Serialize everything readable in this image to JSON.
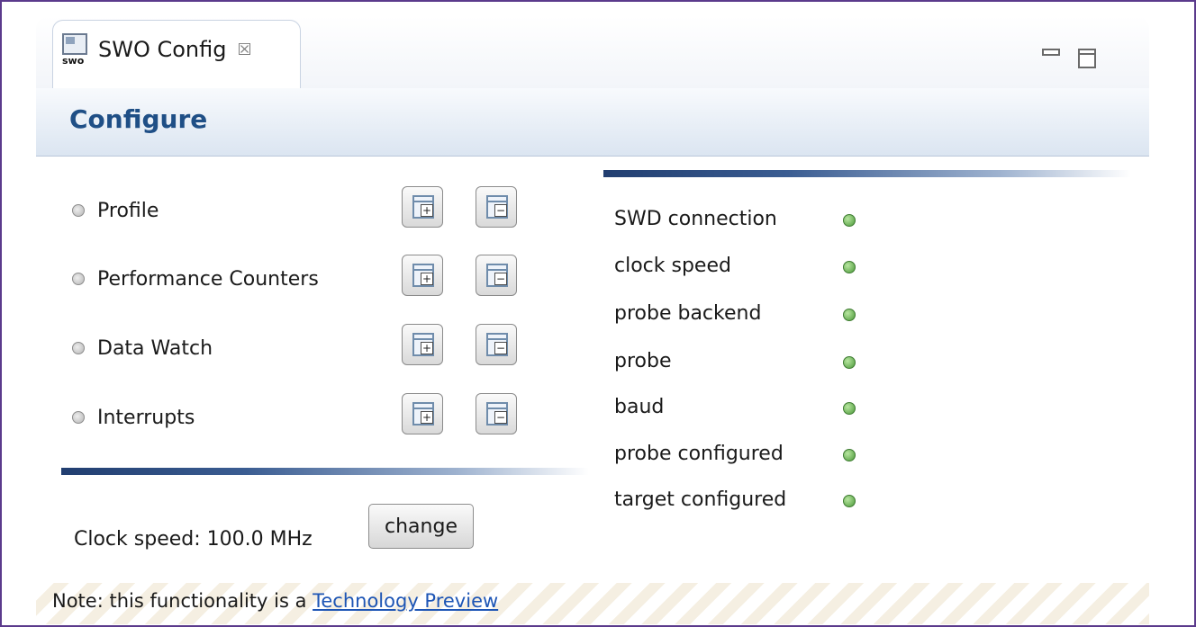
{
  "tab": {
    "label": "SWO Config",
    "icon_text": "swo",
    "close_glyph": "☒"
  },
  "header": {
    "title": "Configure"
  },
  "features": [
    {
      "label": "Profile",
      "enabled": false
    },
    {
      "label": "Performance Counters",
      "enabled": false
    },
    {
      "label": "Data Watch",
      "enabled": false
    },
    {
      "label": "Interrupts",
      "enabled": false
    }
  ],
  "feature_button_icons": {
    "add": "window-add-icon",
    "remove": "window-remove-icon"
  },
  "status": [
    {
      "label": "SWD connection",
      "state": "ok"
    },
    {
      "label": "clock speed",
      "state": "ok"
    },
    {
      "label": "probe backend",
      "state": "ok"
    },
    {
      "label": "probe",
      "state": "ok"
    },
    {
      "label": "baud",
      "state": "ok"
    },
    {
      "label": "probe configured",
      "state": "ok"
    },
    {
      "label": "target configured",
      "state": "ok"
    }
  ],
  "clock": {
    "label": "Clock speed: 100.0 MHz",
    "change_label": "change"
  },
  "note": {
    "prefix": "Note: this functionality is a ",
    "link_text": "Technology Preview"
  },
  "colors": {
    "accent": "#1f4f86",
    "status_ok": "#4c9a3a",
    "frame": "#5b3a8c",
    "link": "#1d55b5"
  }
}
